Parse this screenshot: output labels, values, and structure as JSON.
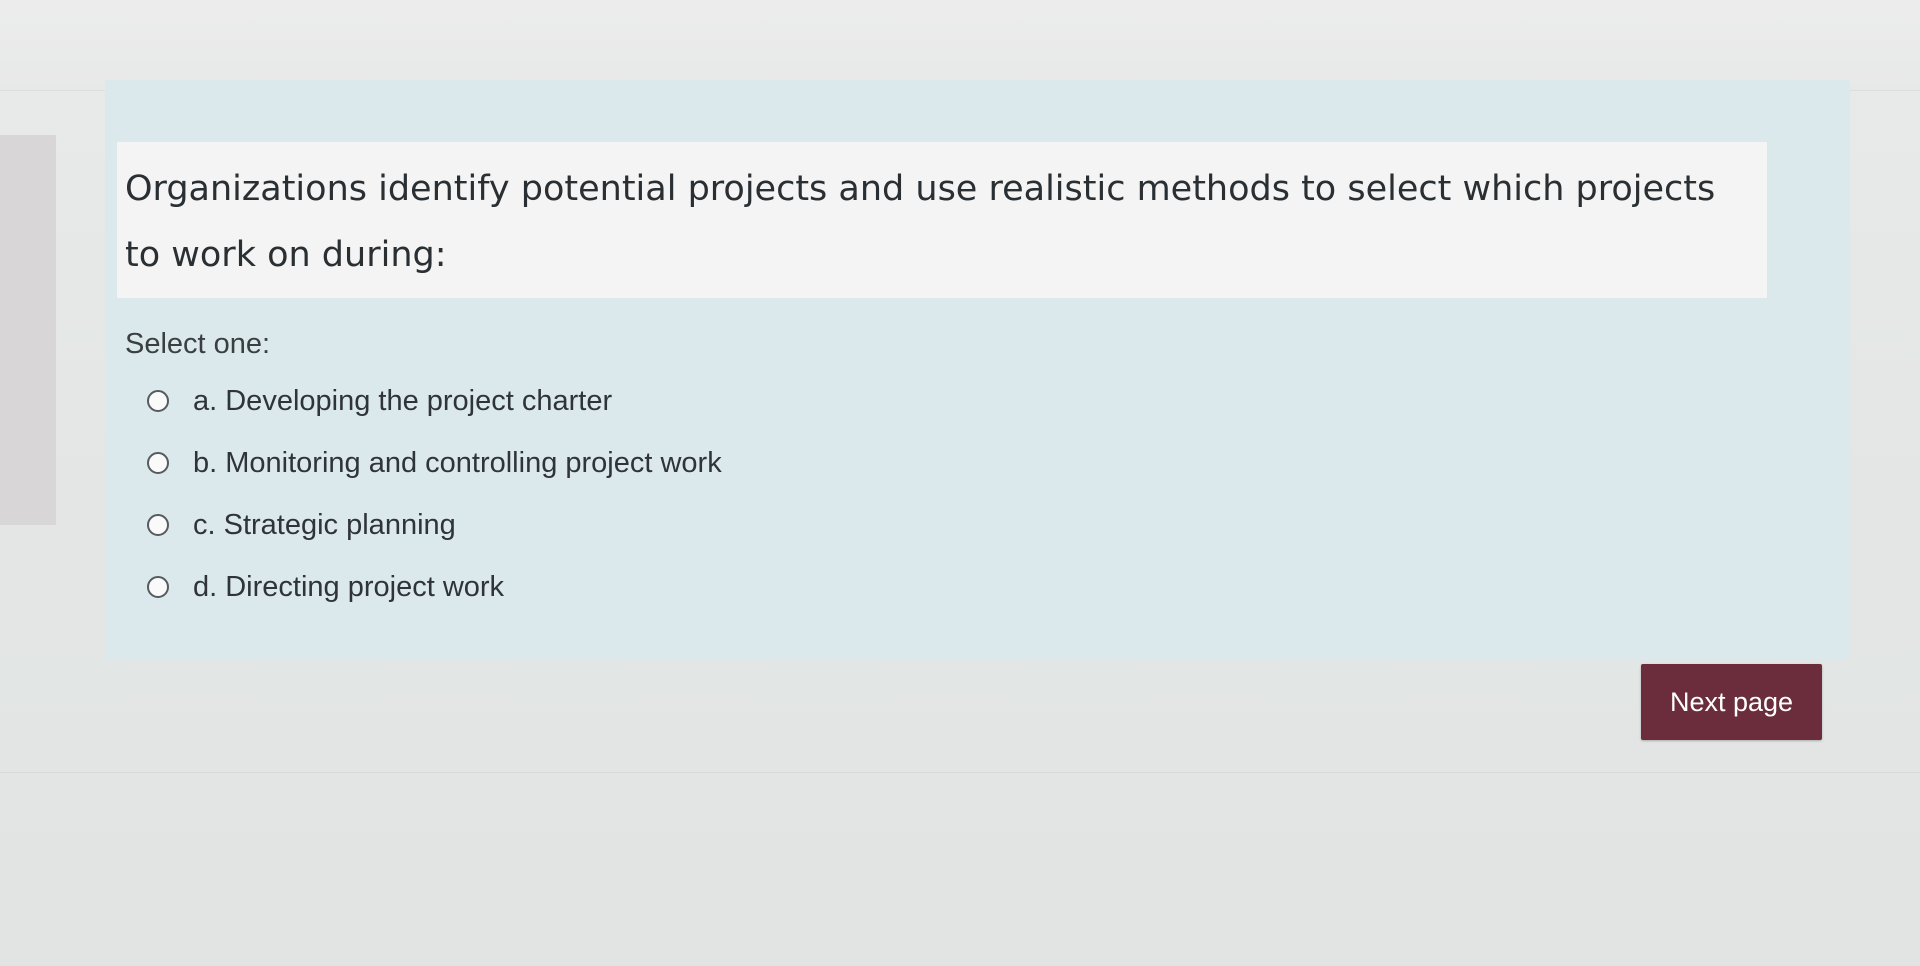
{
  "question": {
    "text": "Organizations identify potential projects and use realistic methods to select which projects to work on during:",
    "prompt": "Select one:",
    "answers": [
      {
        "label": "a. Developing the project charter"
      },
      {
        "label": "b. Monitoring and controlling project work"
      },
      {
        "label": "c. Strategic planning"
      },
      {
        "label": "d. Directing project work"
      }
    ]
  },
  "navigation": {
    "next_label": "Next page"
  },
  "colors": {
    "accent_button": "#6b2d3c",
    "question_background": "#dbe9ec"
  }
}
